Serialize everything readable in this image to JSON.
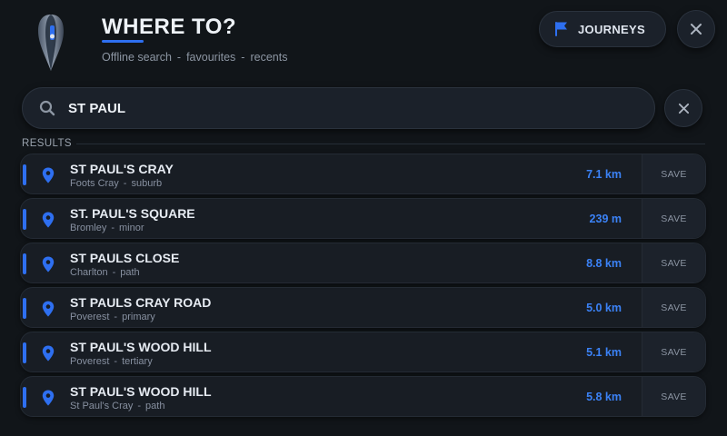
{
  "header": {
    "title": "WHERE TO?",
    "subtitle_parts": [
      "Offline search",
      "favourites",
      "recents"
    ],
    "subtitle_sep": "-",
    "journeys_label": "JOURNEYS"
  },
  "search": {
    "value": "ST PAUL",
    "placeholder": ""
  },
  "results": {
    "label": "RESULTS",
    "save_label": "SAVE",
    "meta_sep": "-",
    "items": [
      {
        "name": "ST PAUL'S CRAY",
        "area": "Foots Cray",
        "kind": "suburb",
        "distance": "7.1 km"
      },
      {
        "name": "ST. PAUL'S SQUARE",
        "area": "Bromley",
        "kind": "minor",
        "distance": "239 m"
      },
      {
        "name": "ST PAULS CLOSE",
        "area": "Charlton",
        "kind": "path",
        "distance": "8.8 km"
      },
      {
        "name": "ST PAULS CRAY ROAD",
        "area": "Poverest",
        "kind": "primary",
        "distance": "5.0 km"
      },
      {
        "name": "ST PAUL'S WOOD HILL",
        "area": "Poverest",
        "kind": "tertiary",
        "distance": "5.1 km"
      },
      {
        "name": "ST PAUL'S WOOD HILL",
        "area": "St Paul's Cray",
        "kind": "path",
        "distance": "5.8 km"
      }
    ]
  },
  "colors": {
    "accent": "#2e6ff0",
    "distance": "#3b82f6",
    "background": "#111519",
    "card": "#181d24"
  },
  "icons": {
    "logo": "map-pin-logo-icon",
    "journeys": "flag-icon",
    "close": "close-icon",
    "search": "search-icon",
    "result": "map-pin-icon"
  }
}
